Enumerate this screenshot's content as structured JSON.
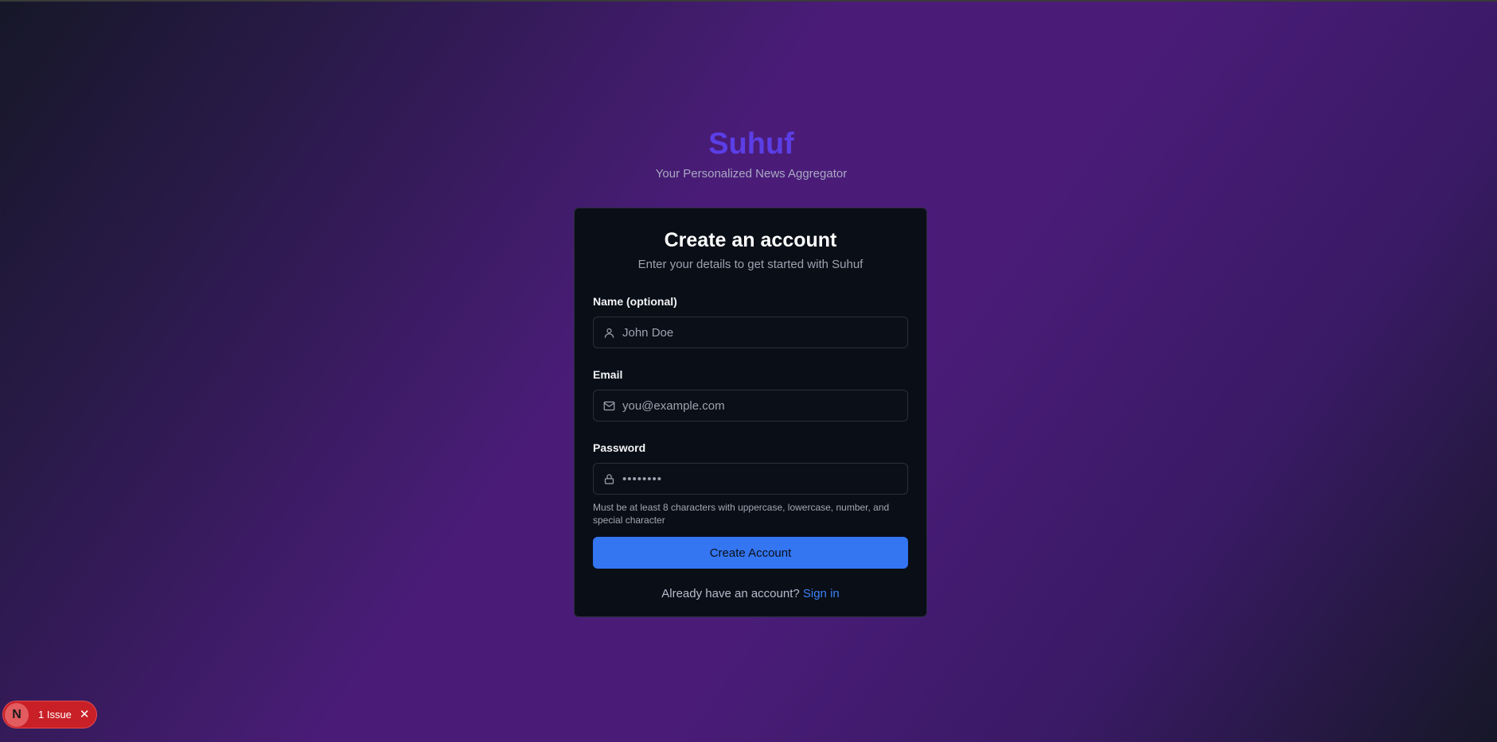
{
  "brand": {
    "title": "Suhuf",
    "subtitle": "Your Personalized News Aggregator"
  },
  "card": {
    "title": "Create an account",
    "subtitle": "Enter your details to get started with Suhuf"
  },
  "form": {
    "name": {
      "label": "Name (optional)",
      "placeholder": "John Doe",
      "icon": "user-icon"
    },
    "email": {
      "label": "Email",
      "placeholder": "you@example.com",
      "icon": "mail-icon"
    },
    "password": {
      "label": "Password",
      "masked_value": "••••••••",
      "icon": "lock-icon",
      "hint": "Must be at least 8 characters with uppercase, lowercase, number, and special character"
    },
    "submit_label": "Create Account"
  },
  "footer": {
    "prompt": "Already have an account?",
    "link_label": "Sign in"
  },
  "dev_indicator": {
    "logo_letter": "N",
    "issue_text": "1 Issue",
    "close_glyph": "✕"
  },
  "colors": {
    "brand": "#5b3ee6",
    "primary_button": "#3476f2",
    "link": "#3b82f6",
    "issue_badge": "#c91f27"
  }
}
